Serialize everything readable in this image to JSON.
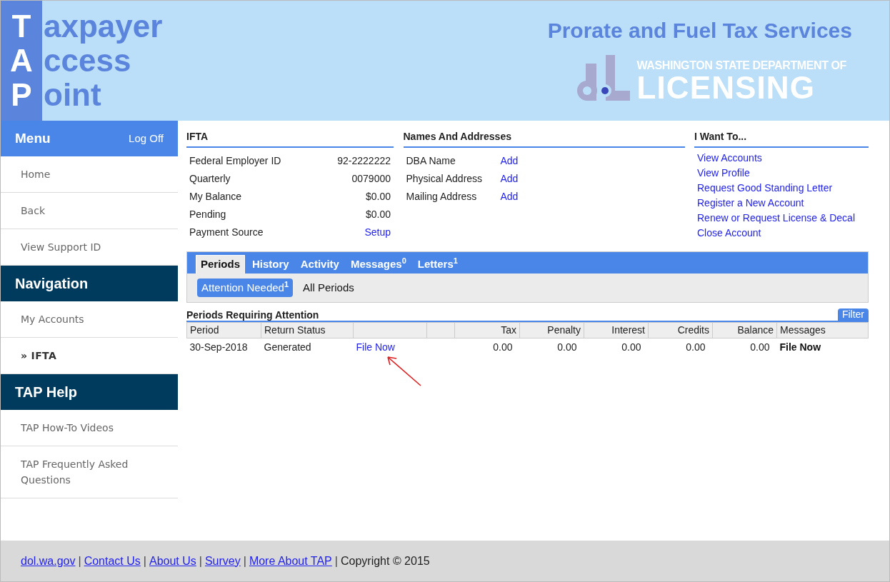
{
  "header": {
    "logo": [
      {
        "initial": "T",
        "rest": "axpayer"
      },
      {
        "initial": "A",
        "rest": "ccess"
      },
      {
        "initial": "P",
        "rest": "oint"
      }
    ],
    "service_title": "Prorate and Fuel Tax Services",
    "agency_line": "WASHINGTON STATE DEPARTMENT OF",
    "agency_name": "LICENSING"
  },
  "sidebar": {
    "sections": [
      {
        "title": "Menu",
        "action": "Log Off",
        "kind": "menu",
        "items": [
          {
            "label": "Home",
            "selected": false
          },
          {
            "label": "Back",
            "selected": false
          },
          {
            "label": "View Support ID",
            "selected": false
          }
        ]
      },
      {
        "title": "Navigation",
        "kind": "section",
        "items": [
          {
            "label": "My Accounts",
            "selected": false
          },
          {
            "label": "» IFTA",
            "selected": true
          }
        ]
      },
      {
        "title": "TAP Help",
        "kind": "section",
        "items": [
          {
            "label": "TAP How-To Videos",
            "selected": false
          },
          {
            "label": "TAP Frequently Asked Questions",
            "selected": false
          }
        ]
      }
    ]
  },
  "account": {
    "title": "IFTA",
    "fields": [
      {
        "label": "Federal Employer ID",
        "value": "92-2222222",
        "kind": "text"
      },
      {
        "label": "Quarterly",
        "value": "0079000",
        "kind": "text"
      },
      {
        "label": "My Balance",
        "value": "$0.00",
        "kind": "text"
      },
      {
        "label": "Pending",
        "value": "$0.00",
        "kind": "text"
      },
      {
        "label": "Payment Source",
        "value": "Setup",
        "kind": "link"
      }
    ]
  },
  "names": {
    "title": "Names And Addresses",
    "fields": [
      {
        "label": "DBA Name",
        "value": "Add",
        "kind": "link"
      },
      {
        "label": "Physical Address",
        "value": "Add",
        "kind": "link"
      },
      {
        "label": "Mailing Address",
        "value": "Add",
        "kind": "link"
      }
    ]
  },
  "i_want_to": {
    "title": "I Want To...",
    "links": [
      "View Accounts",
      "View Profile",
      "Request Good Standing Letter",
      "Register a New Account",
      "Renew or Request License & Decal",
      "Close Account"
    ]
  },
  "tabs": [
    {
      "label": "Periods",
      "selected": true
    },
    {
      "label": "History",
      "selected": false
    },
    {
      "label": "Activity",
      "selected": false
    },
    {
      "label": "Messages",
      "count": "0",
      "selected": false
    },
    {
      "label": "Letters",
      "count": "1",
      "selected": false
    }
  ],
  "subtabs": [
    {
      "label": "Attention Needed",
      "count": "1",
      "selected": true
    },
    {
      "label": "All Periods",
      "selected": false
    }
  ],
  "periods": {
    "title": "Periods Requiring Attention",
    "filter": "Filter",
    "columns": [
      {
        "label": "Period",
        "kind": "text"
      },
      {
        "label": "Return Status",
        "kind": "text"
      },
      {
        "kind": "blank"
      },
      {
        "kind": "blank"
      },
      {
        "label": "Tax",
        "kind": "number"
      },
      {
        "label": "Penalty",
        "kind": "number"
      },
      {
        "label": "Interest",
        "kind": "number"
      },
      {
        "label": "Credits",
        "kind": "number"
      },
      {
        "label": "Balance",
        "kind": "number"
      },
      {
        "label": "Messages",
        "kind": "text"
      }
    ],
    "rows": [
      {
        "cells": [
          {
            "kind": "text",
            "text": "30-Sep-2018"
          },
          {
            "kind": "text",
            "text": "Generated"
          },
          {
            "kind": "link",
            "text": "File Now"
          },
          {
            "kind": "blank"
          },
          {
            "kind": "text",
            "text": "0.00"
          },
          {
            "kind": "text",
            "text": "0.00"
          },
          {
            "kind": "text",
            "text": "0.00"
          },
          {
            "kind": "text",
            "text": "0.00"
          },
          {
            "kind": "text",
            "text": "0.00"
          },
          {
            "kind": "bold",
            "text": "File Now"
          }
        ]
      }
    ]
  },
  "footer": {
    "links": [
      "dol.wa.gov",
      "Contact Us",
      "About Us",
      "Survey",
      "More About TAP"
    ],
    "separator": "|",
    "copyright": "Copyright © 2015"
  }
}
